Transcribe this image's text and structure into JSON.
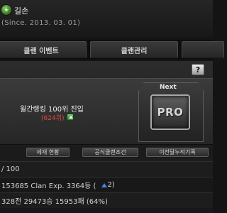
{
  "header": {
    "clan_name": "길손",
    "since": "(Since. 2013. 03. 01)"
  },
  "tabs": [
    {
      "label": "클랜 이벤트"
    },
    {
      "label": "클랜관리"
    },
    {
      "label": ""
    }
  ],
  "help": {
    "label": "?"
  },
  "rank_panel": {
    "title": "월간랭킹 100위 진입",
    "rank_change": "(624위)",
    "next_label": "Next",
    "next_emblem_text": "PRO"
  },
  "buttons": {
    "sanction_status": "제재 현황",
    "official_clan_conditions": "공식클랜조건",
    "previous_month_ranking": "이전달누적기록"
  },
  "stats": {
    "members": "/ 100",
    "exp": "153685 Clan Exp.  3364등  (",
    "exp_rank_change": "2)",
    "record": "328전 29473승 15953패 (64%)"
  },
  "colors": {
    "accent_red": "#e04848",
    "rank_up_blue": "#4f7fe8"
  }
}
